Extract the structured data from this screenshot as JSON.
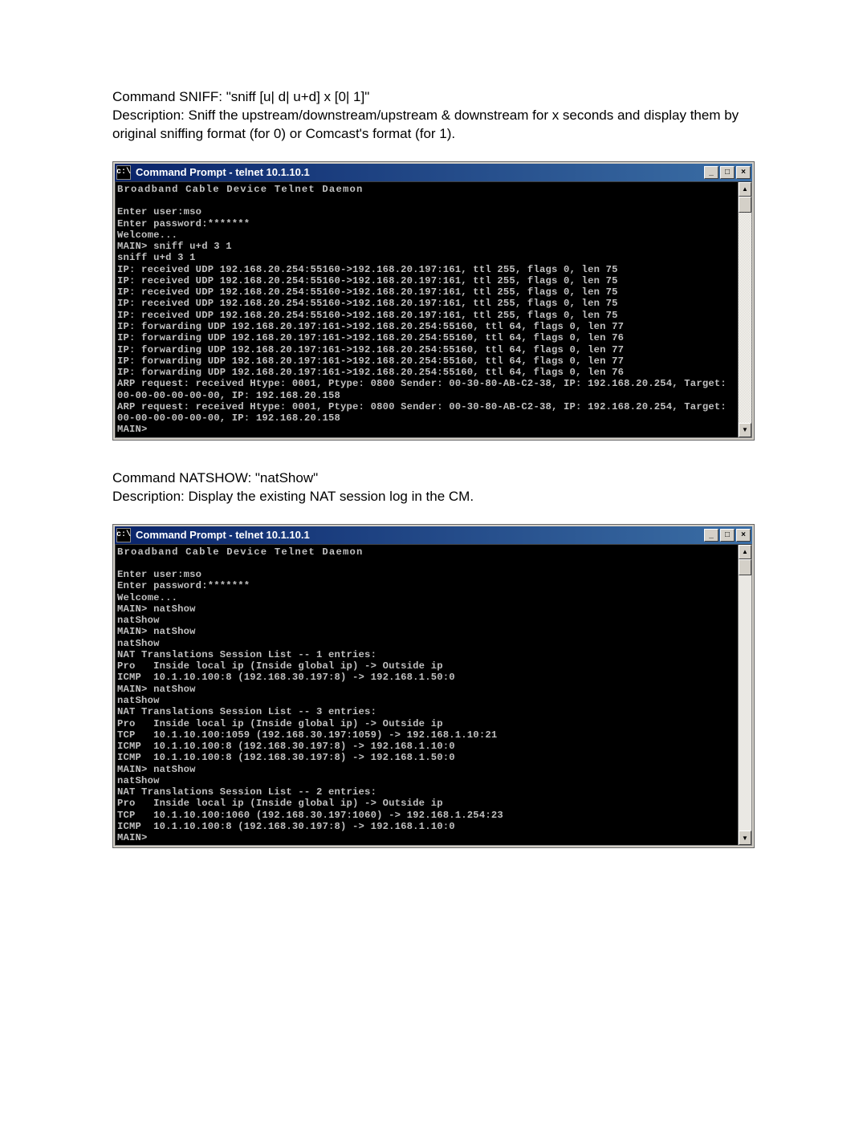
{
  "section1": {
    "command_line": "Command SNIFF: \"sniff [u| d| u+d] x [0| 1]\"",
    "description": "Description: Sniff the upstream/downstream/upstream & downstream for x seconds and display them by original sniffing format (for 0) or Comcast's format (for 1)."
  },
  "terminal1": {
    "title": "Command Prompt - telnet 10.1.10.1",
    "icon_text": "c:\\",
    "header": "Broadband Cable Device Telnet Daemon",
    "lines": [
      "",
      "Enter user:mso",
      "Enter password:*******",
      "Welcome...",
      "MAIN> sniff u+d 3 1",
      "sniff u+d 3 1",
      "IP: received UDP 192.168.20.254:55160->192.168.20.197:161, ttl 255, flags 0, len 75",
      "IP: received UDP 192.168.20.254:55160->192.168.20.197:161, ttl 255, flags 0, len 75",
      "IP: received UDP 192.168.20.254:55160->192.168.20.197:161, ttl 255, flags 0, len 75",
      "IP: received UDP 192.168.20.254:55160->192.168.20.197:161, ttl 255, flags 0, len 75",
      "IP: received UDP 192.168.20.254:55160->192.168.20.197:161, ttl 255, flags 0, len 75",
      "IP: forwarding UDP 192.168.20.197:161->192.168.20.254:55160, ttl 64, flags 0, len 77",
      "IP: forwarding UDP 192.168.20.197:161->192.168.20.254:55160, ttl 64, flags 0, len 76",
      "IP: forwarding UDP 192.168.20.197:161->192.168.20.254:55160, ttl 64, flags 0, len 77",
      "IP: forwarding UDP 192.168.20.197:161->192.168.20.254:55160, ttl 64, flags 0, len 77",
      "IP: forwarding UDP 192.168.20.197:161->192.168.20.254:55160, ttl 64, flags 0, len 76",
      "ARP request: received Htype: 0001, Ptype: 0800 Sender: 00-30-80-AB-C2-38, IP: 192.168.20.254, Target: 00-00-00-00-00-00, IP: 192.168.20.158",
      "ARP request: received Htype: 0001, Ptype: 0800 Sender: 00-30-80-AB-C2-38, IP: 192.168.20.254, Target: 00-00-00-00-00-00, IP: 192.168.20.158",
      "MAIN>"
    ]
  },
  "section2": {
    "command_line": "Command NATSHOW: \"natShow\"",
    "description": "Description: Display the existing NAT session log in the CM."
  },
  "terminal2": {
    "title": "Command Prompt - telnet 10.1.10.1",
    "icon_text": "c:\\",
    "header": "Broadband Cable Device Telnet Daemon",
    "lines": [
      "",
      "Enter user:mso",
      "Enter password:*******",
      "Welcome...",
      "MAIN> natShow",
      "natShow",
      "MAIN> natShow",
      "natShow",
      "NAT Translations Session List -- 1 entries:",
      "Pro   Inside local ip (Inside global ip) -> Outside ip",
      "ICMP  10.1.10.100:8 (192.168.30.197:8) -> 192.168.1.50:0",
      "MAIN> natShow",
      "natShow",
      "NAT Translations Session List -- 3 entries:",
      "Pro   Inside local ip (Inside global ip) -> Outside ip",
      "TCP   10.1.10.100:1059 (192.168.30.197:1059) -> 192.168.1.10:21",
      "ICMP  10.1.10.100:8 (192.168.30.197:8) -> 192.168.1.10:0",
      "ICMP  10.1.10.100:8 (192.168.30.197:8) -> 192.168.1.50:0",
      "MAIN> natShow",
      "natShow",
      "NAT Translations Session List -- 2 entries:",
      "Pro   Inside local ip (Inside global ip) -> Outside ip",
      "TCP   10.1.10.100:1060 (192.168.30.197:1060) -> 192.168.1.254:23",
      "ICMP  10.1.10.100:8 (192.168.30.197:8) -> 192.168.1.10:0",
      "MAIN>"
    ]
  },
  "window_buttons": {
    "minimize": "_",
    "maximize": "□",
    "close": "×"
  },
  "scrollbar": {
    "up": "▲",
    "down": "▼"
  }
}
